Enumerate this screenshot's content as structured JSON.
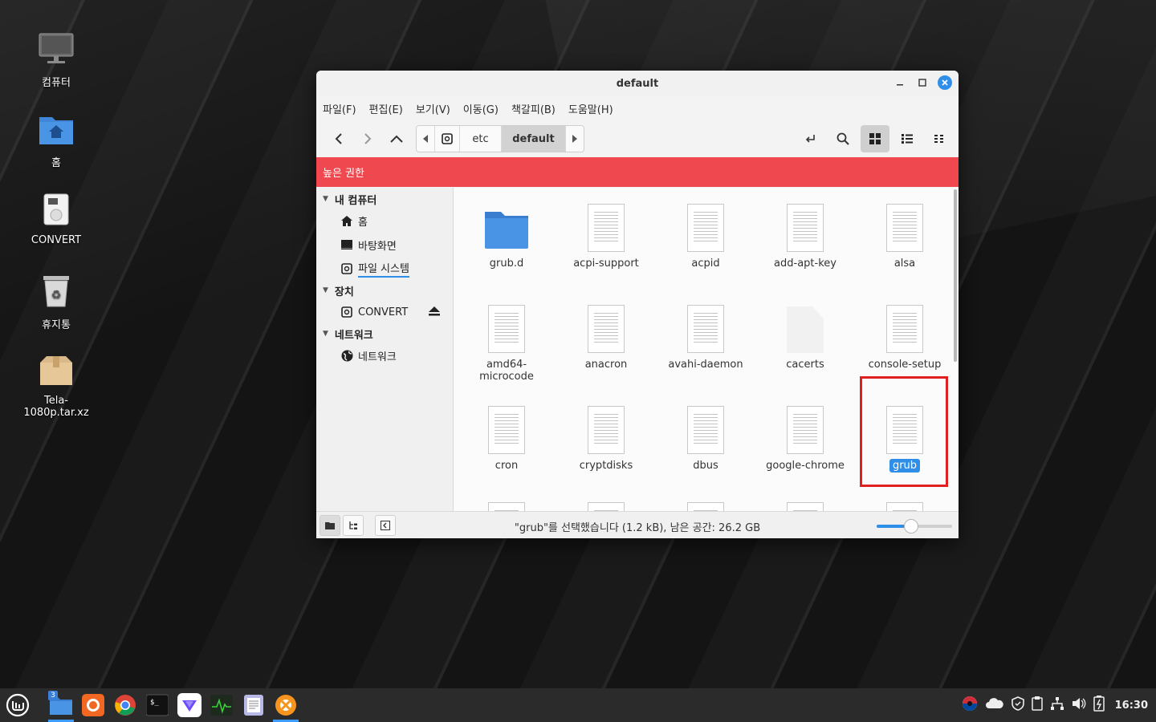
{
  "desktop": {
    "icons": [
      {
        "label": "컴퓨터",
        "icon": "computer-icon"
      },
      {
        "label": "홈",
        "icon": "home-folder-icon"
      },
      {
        "label": "CONVERT",
        "icon": "drive-icon"
      },
      {
        "label": "휴지통",
        "icon": "trash-icon"
      },
      {
        "label": "Tela-1080p.tar.xz",
        "icon": "archive-icon"
      }
    ]
  },
  "window": {
    "title": "default",
    "menu": [
      "파일(F)",
      "편집(E)",
      "보기(V)",
      "이동(G)",
      "책갈피(B)",
      "도움말(H)"
    ],
    "path": [
      "etc",
      "default"
    ],
    "elevated_banner": "높은 권한",
    "sidebar": {
      "sections": [
        {
          "title": "내 컴퓨터",
          "items": [
            {
              "label": "홈",
              "icon": "home-icon"
            },
            {
              "label": "바탕화면",
              "icon": "desktop-icon"
            },
            {
              "label": "파일 시스템",
              "icon": "filesystem-icon"
            }
          ]
        },
        {
          "title": "장치",
          "items": [
            {
              "label": "CONVERT",
              "icon": "drive-icon"
            }
          ]
        },
        {
          "title": "네트워크",
          "items": [
            {
              "label": "네트워크",
              "icon": "network-icon"
            }
          ]
        }
      ]
    },
    "files": [
      {
        "name": "grub.d",
        "type": "folder"
      },
      {
        "name": "acpi-support",
        "type": "text"
      },
      {
        "name": "acpid",
        "type": "text"
      },
      {
        "name": "add-apt-key",
        "type": "text"
      },
      {
        "name": "alsa",
        "type": "text"
      },
      {
        "name": "amd64-microcode",
        "type": "text"
      },
      {
        "name": "anacron",
        "type": "text"
      },
      {
        "name": "avahi-daemon",
        "type": "text"
      },
      {
        "name": "cacerts",
        "type": "blank"
      },
      {
        "name": "console-setup",
        "type": "text"
      },
      {
        "name": "cron",
        "type": "text"
      },
      {
        "name": "cryptdisks",
        "type": "text"
      },
      {
        "name": "dbus",
        "type": "text"
      },
      {
        "name": "google-chrome",
        "type": "text"
      },
      {
        "name": "grub",
        "type": "text",
        "selected": true
      }
    ],
    "status": "\"grub\"를 선택했습니다 (1.2 kB), 남은 공간: 26.2 GB",
    "zoom_level": 0.45
  },
  "taskbar": {
    "apps": [
      "menu-icon",
      "files-icon",
      "firefox-icon",
      "chrome-icon",
      "terminal-icon",
      "protonvpn-icon",
      "system-monitor-icon",
      "text-editor-icon",
      "xnview-icon"
    ],
    "files_badge": "3",
    "clock": "16:30"
  },
  "colors": {
    "accent": "#2f8fe8",
    "banner": "#f0484f",
    "highlight": "#e02020"
  }
}
